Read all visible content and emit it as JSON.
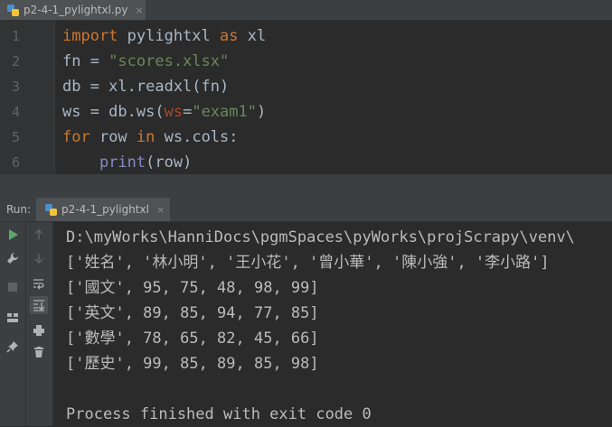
{
  "editor": {
    "tab_title": "p2-4-1_pylightxl.py",
    "tab_close": "×",
    "line_numbers": [
      "1",
      "2",
      "3",
      "4",
      "5",
      "6"
    ],
    "lines": [
      [
        {
          "t": "import",
          "c": "kw"
        },
        {
          "t": " pylightxl ",
          "c": ""
        },
        {
          "t": "as",
          "c": "kw"
        },
        {
          "t": " xl",
          "c": ""
        }
      ],
      [
        {
          "t": "fn = ",
          "c": ""
        },
        {
          "t": "\"scores.xlsx\"",
          "c": "str"
        }
      ],
      [
        {
          "t": "db = xl.readxl(fn)",
          "c": ""
        }
      ],
      [
        {
          "t": "ws = db.ws(",
          "c": ""
        },
        {
          "t": "ws",
          "c": "param"
        },
        {
          "t": "=",
          "c": ""
        },
        {
          "t": "\"exam1\"",
          "c": "str"
        },
        {
          "t": ")",
          "c": ""
        }
      ],
      [
        {
          "t": "for",
          "c": "kw"
        },
        {
          "t": " row ",
          "c": ""
        },
        {
          "t": "in",
          "c": "kw"
        },
        {
          "t": " ws.cols:",
          "c": ""
        }
      ],
      [
        {
          "t": "    ",
          "c": ""
        },
        {
          "t": "print",
          "c": "builtin"
        },
        {
          "t": "(row)",
          "c": ""
        }
      ]
    ]
  },
  "run_panel": {
    "label": "Run:",
    "tab_title": "p2-4-1_pylightxl",
    "tab_close": "×",
    "tools_left": [
      "run-icon",
      "wrench-icon",
      "stop-icon",
      "layout-icon",
      "pin-icon"
    ],
    "tools_right": [
      "up-arrow-icon",
      "down-arrow-icon",
      "soft-wrap-icon",
      "scroll-to-end-icon",
      "print-icon",
      "trash-icon"
    ]
  },
  "console": {
    "lines": [
      "D:\\myWorks\\HanniDocs\\pgmSpaces\\pyWorks\\projScrapy\\venv\\",
      "['姓名', '林小明', '王小花', '曾小華', '陳小強', '李小路']",
      "['國文', 95, 75, 48, 98, 99]",
      "['英文', 89, 85, 94, 77, 85]",
      "['數學', 78, 65, 82, 45, 66]",
      "['歷史', 99, 85, 89, 85, 98]",
      "",
      "Process finished with exit code 0"
    ]
  },
  "colors": {
    "keyword": "#cc7832",
    "string": "#6a8759",
    "param": "#aa4926",
    "builtin": "#8888c6",
    "text": "#a9b7c6",
    "background": "#2b2b2b",
    "run_green": "#59a869"
  }
}
